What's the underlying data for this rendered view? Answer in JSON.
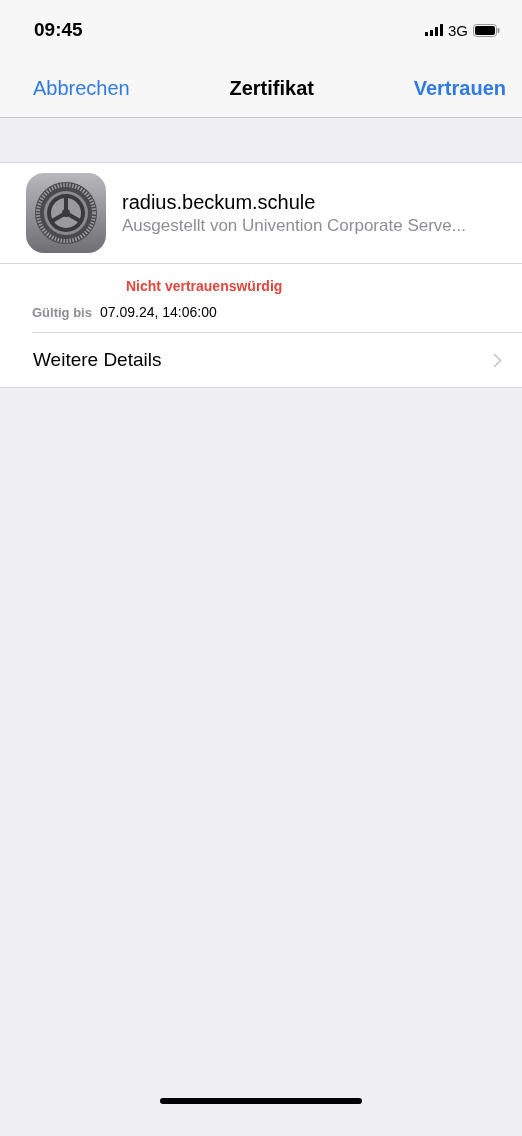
{
  "status_bar": {
    "time": "09:45",
    "network": "3G"
  },
  "nav": {
    "cancel": "Abbrechen",
    "title": "Zertifikat",
    "trust": "Vertrauen"
  },
  "certificate": {
    "name": "radius.beckum.schule",
    "issuer": "Ausgestellt von Univention Corporate Serve...",
    "status": {
      "text": "Nicht vertrauenswürdig",
      "trusted": false
    },
    "valid_label": "Gültig bis",
    "valid_value": "07.09.24, 14:06:00"
  },
  "details": {
    "label": "Weitere Details"
  }
}
